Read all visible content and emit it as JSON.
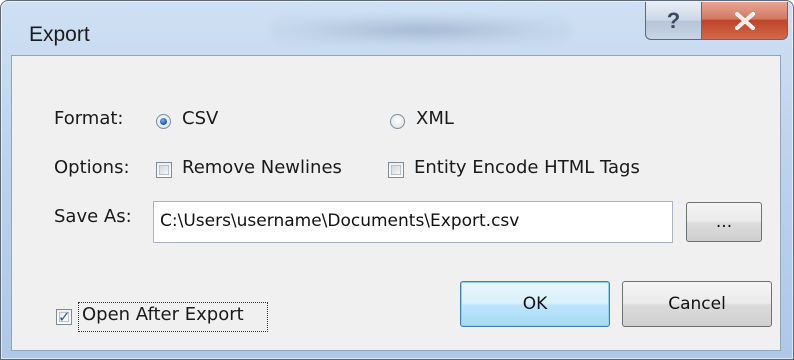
{
  "window": {
    "title": "Export",
    "help_glyph": "?",
    "close_icon": "close-x-icon"
  },
  "format": {
    "label": "Format:",
    "options": [
      {
        "label": "CSV",
        "selected": true
      },
      {
        "label": "XML",
        "selected": false
      }
    ]
  },
  "options": {
    "label": "Options:",
    "items": [
      {
        "label": "Remove Newlines",
        "checked": false
      },
      {
        "label": "Entity Encode HTML Tags",
        "checked": false
      }
    ]
  },
  "save_as": {
    "label": "Save As:",
    "value": "C:\\Users\\username\\Documents\\Export.csv",
    "browse_label": "..."
  },
  "open_after_export": {
    "label": "Open After Export",
    "checked": true
  },
  "buttons": {
    "ok": "OK",
    "cancel": "Cancel"
  },
  "colors": {
    "accent": "#2765c5",
    "close_button": "#c0432a",
    "panel": "#f0f0f0"
  }
}
